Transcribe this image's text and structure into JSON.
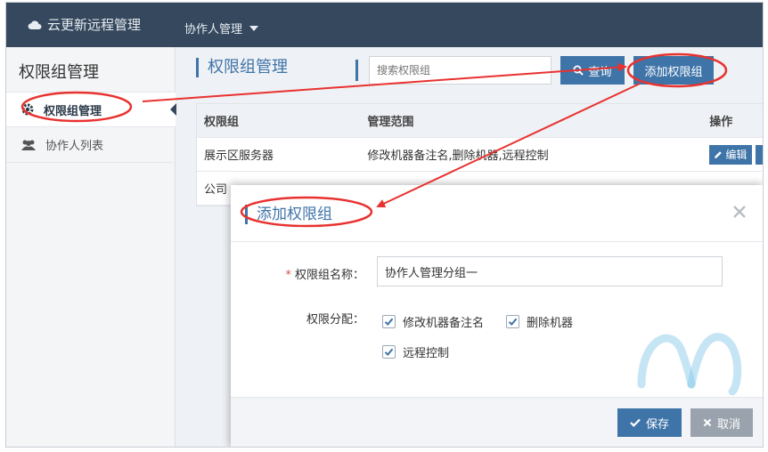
{
  "topbar": {
    "brand": "云更新远程管理",
    "nav_collab": "协作人管理"
  },
  "sidebar": {
    "title": "权限组管理",
    "items": [
      {
        "label": "权限组管理",
        "icon": "gear-icon"
      },
      {
        "label": "协作人列表",
        "icon": "users-icon"
      }
    ]
  },
  "main": {
    "title": "权限组管理",
    "search_placeholder": "搜索权限组",
    "query_label": "查询",
    "add_label": "添加权限组"
  },
  "table": {
    "headers": [
      "权限组",
      "管理范围",
      "操作"
    ],
    "rows": [
      {
        "group": "展示区服务器",
        "scope": "修改机器备注名,删除机器,远程控制",
        "action": "编辑"
      },
      {
        "group": "公司",
        "scope": "",
        "action": ""
      }
    ]
  },
  "modal": {
    "title": "添加权限组",
    "name_label": "权限组名称：",
    "name_required": "*",
    "name_value": "协作人管理分组一",
    "assign_label": "权限分配：",
    "permissions": [
      {
        "label": "修改机器备注名",
        "checked": true
      },
      {
        "label": "删除机器",
        "checked": true
      },
      {
        "label": "远程控制",
        "checked": true
      }
    ],
    "save_label": "保存",
    "cancel_label": "取消"
  },
  "colors": {
    "topbar": "#35485d",
    "accent": "#3f74a8",
    "annotation": "#e8322f",
    "cancel": "#9aa3ad"
  }
}
